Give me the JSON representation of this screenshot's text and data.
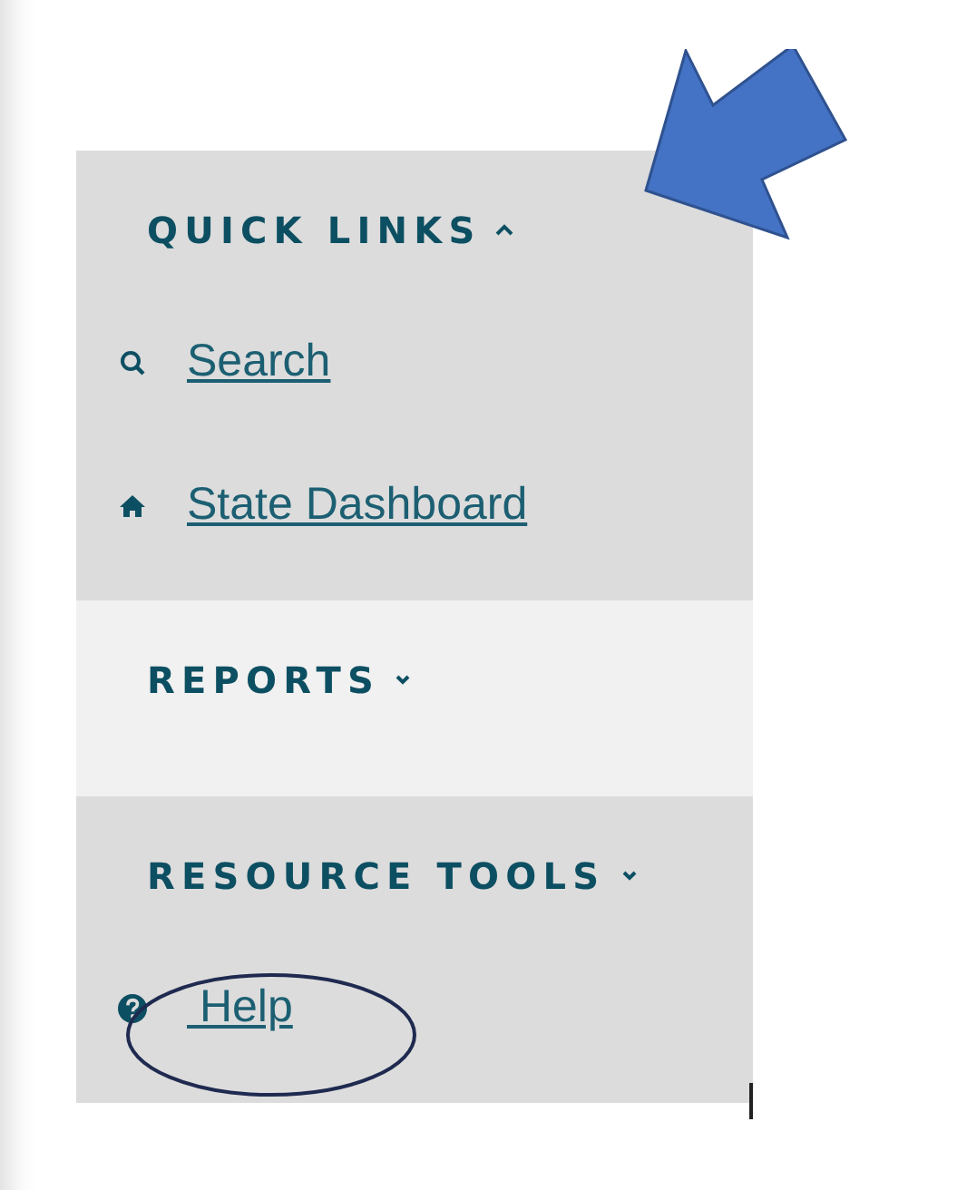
{
  "sections": [
    {
      "title": "QUICK LINKS",
      "expanded": true,
      "highlighted": false,
      "links": [
        {
          "kind": "search",
          "label": "Search"
        },
        {
          "kind": "home",
          "label": "State Dashboard"
        }
      ]
    },
    {
      "title": "REPORTS",
      "expanded": false,
      "highlighted": true
    },
    {
      "title": "RESOURCE TOOLS",
      "expanded": false,
      "highlighted": false,
      "links": [
        {
          "kind": "help",
          "label": " Help"
        }
      ]
    }
  ]
}
